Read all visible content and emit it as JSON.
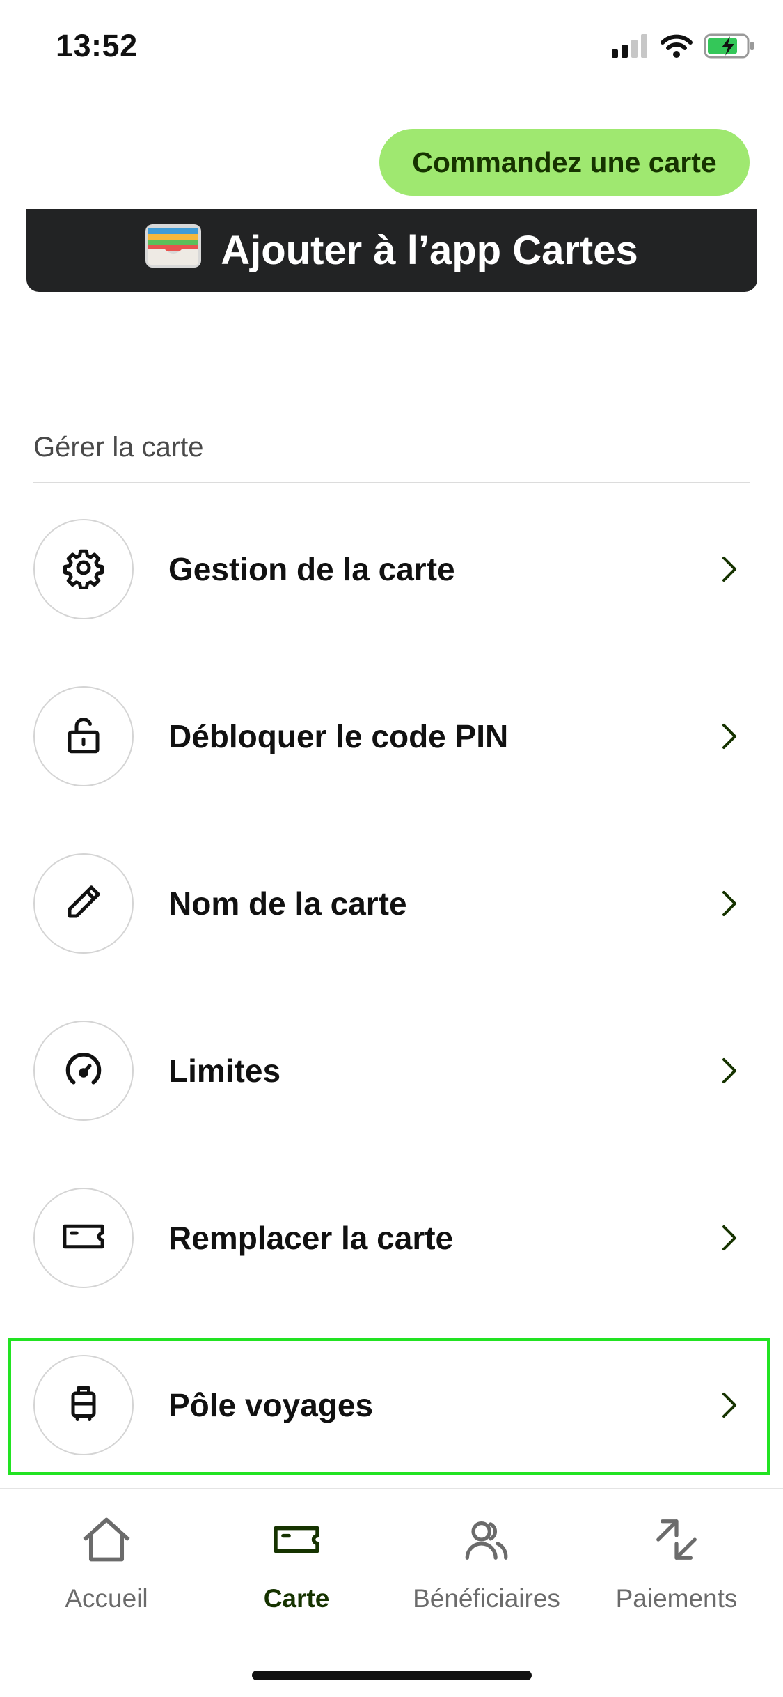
{
  "status_bar": {
    "time": "13:52",
    "icons": [
      "cellular-signal-icon",
      "wifi-icon",
      "battery-charging-icon"
    ]
  },
  "order_button": {
    "label": "Commandez une carte",
    "color": "#9fe870",
    "text_color": "#163300"
  },
  "wallet_button": {
    "label": "Ajouter à l’app Cartes",
    "icon": "wallet-icon"
  },
  "section": {
    "title": "Gérer la carte",
    "items": [
      {
        "label": "Gestion de la carte",
        "icon": "gear-icon"
      },
      {
        "label": "Débloquer le code PIN",
        "icon": "unlock-icon"
      },
      {
        "label": "Nom de la carte",
        "icon": "pencil-icon"
      },
      {
        "label": "Limites",
        "icon": "speedometer-icon"
      },
      {
        "label": "Remplacer la carte",
        "icon": "card-icon"
      },
      {
        "label": "Pôle voyages",
        "icon": "suitcase-icon"
      }
    ]
  },
  "tab_bar": {
    "tabs": [
      {
        "label": "Accueil",
        "icon": "home-icon",
        "active": false
      },
      {
        "label": "Carte",
        "icon": "card-icon",
        "active": true
      },
      {
        "label": "Bénéficiaires",
        "icon": "recipients-icon",
        "active": false
      },
      {
        "label": "Paiements",
        "icon": "transfer-arrows-icon",
        "active": false
      }
    ]
  },
  "colors": {
    "accent_green": "#9fe870",
    "active_tab": "#163300",
    "highlight_border": "#22e322"
  }
}
